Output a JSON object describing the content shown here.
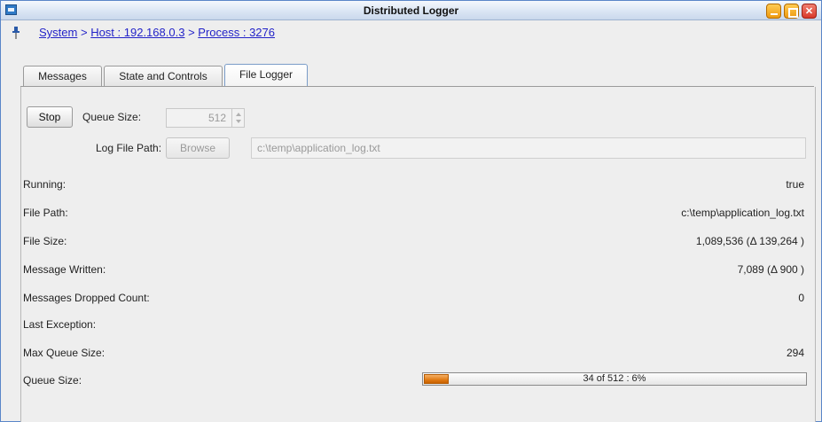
{
  "window": {
    "title": "Distributed Logger"
  },
  "breadcrumb": {
    "items": [
      "System",
      "Host : 192.168.0.3",
      "Process : 3276"
    ],
    "separator": ">"
  },
  "tabs": [
    {
      "label": "Messages",
      "active": false
    },
    {
      "label": "State and Controls",
      "active": false
    },
    {
      "label": "File Logger",
      "active": true
    }
  ],
  "controls": {
    "stop_label": "Stop",
    "queue_size_label": "Queue Size:",
    "queue_size_value": "512",
    "log_file_path_label": "Log File Path:",
    "browse_label": "Browse",
    "log_file_path_value": "c:\\temp\\application_log.txt"
  },
  "stats": [
    {
      "label": "Running:",
      "value": "true"
    },
    {
      "label": "File Path:",
      "value": "c:\\temp\\application_log.txt"
    },
    {
      "label": "File Size:",
      "value": "1,089,536  (Δ 139,264 )"
    },
    {
      "label": "Message Written:",
      "value": "7,089  (Δ 900 )"
    },
    {
      "label": "Messages Dropped Count:",
      "value": "0"
    },
    {
      "label": "Last Exception:",
      "value": ""
    },
    {
      "label": "Max Queue Size:",
      "value": "294"
    },
    {
      "label": "Queue Size:",
      "value": ""
    }
  ],
  "queue_progress": {
    "text": "34 of 512  :  6%",
    "fraction": 0.066
  },
  "colors": {
    "link": "#2323c8",
    "progress_fill": "#e07a14",
    "window_border": "#5a86c8"
  }
}
